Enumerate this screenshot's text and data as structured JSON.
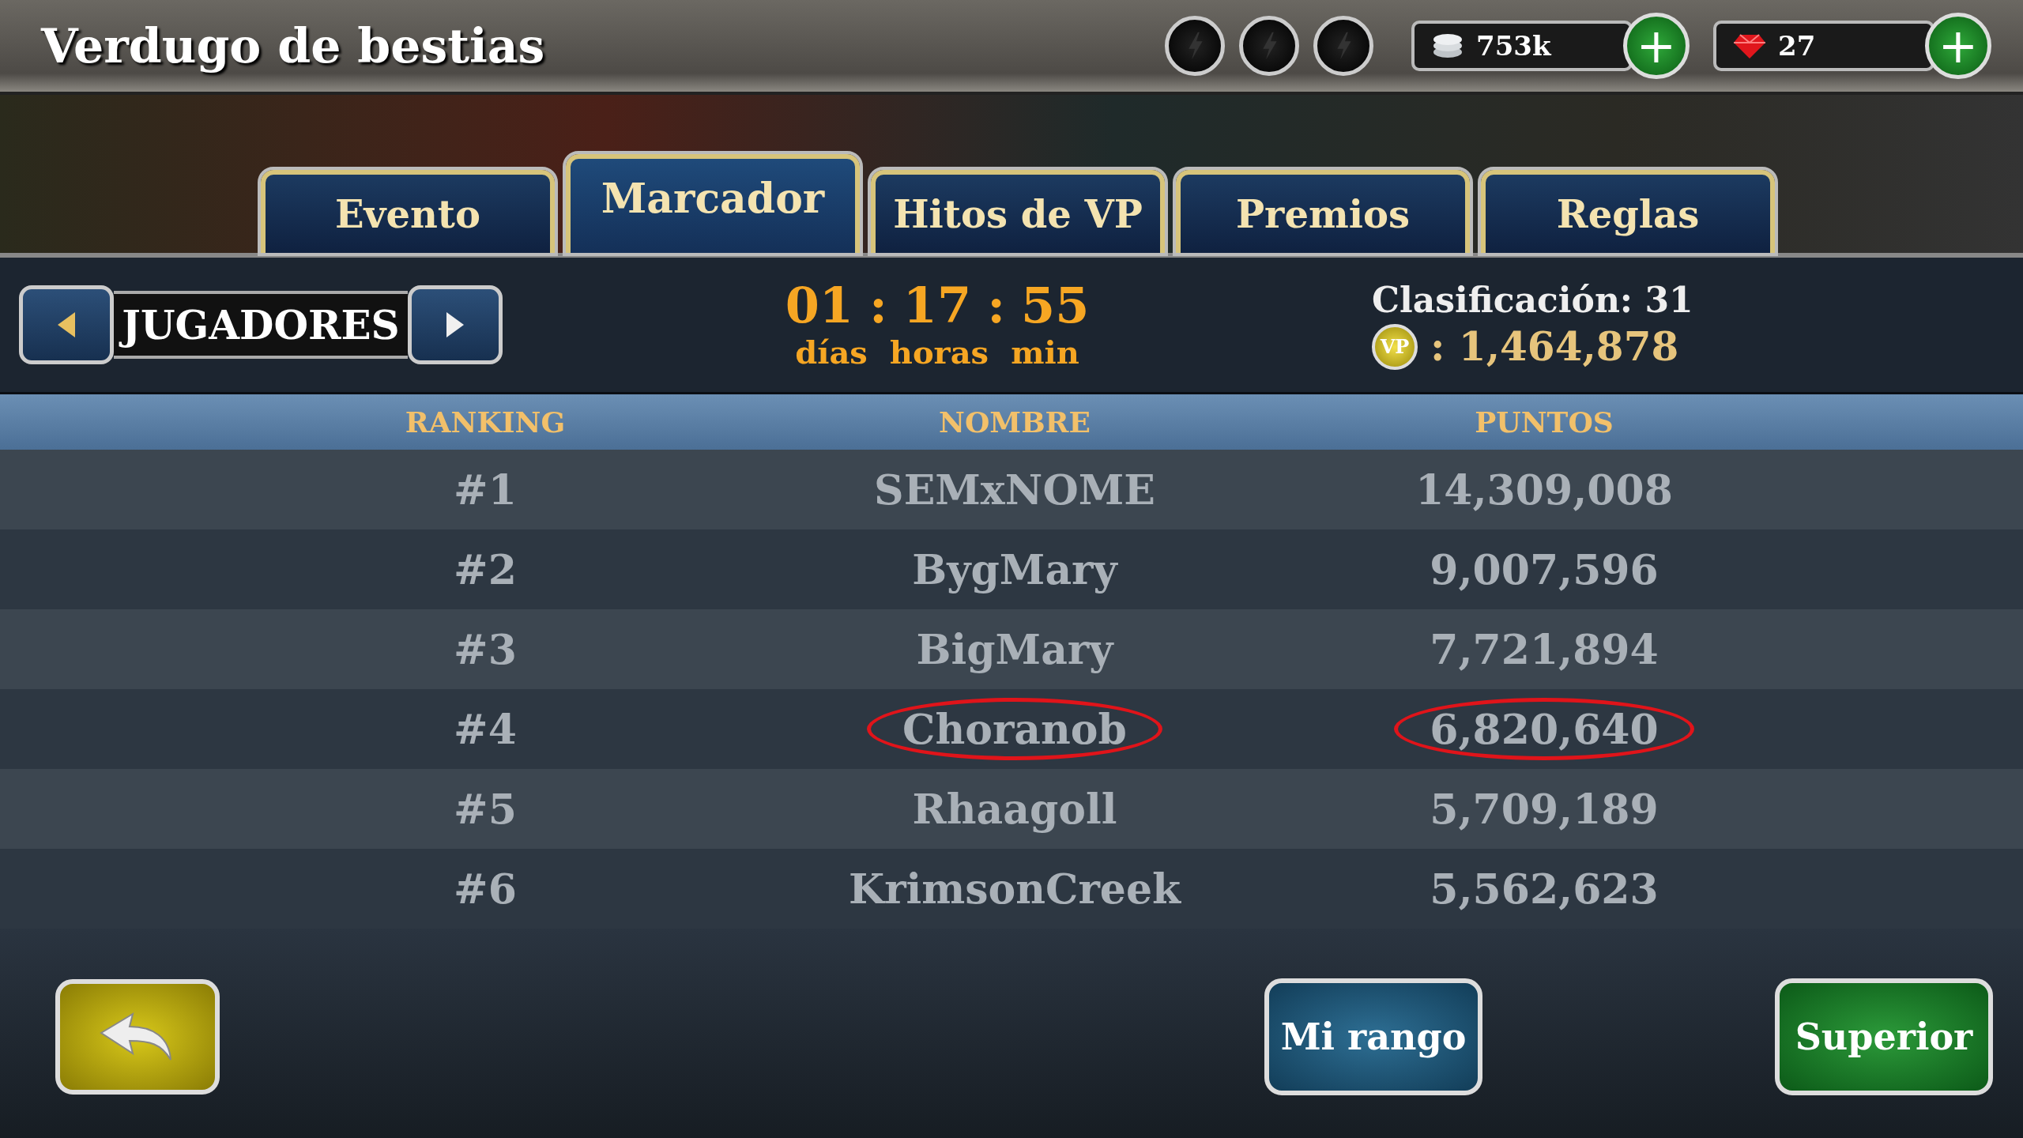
{
  "title": "Verdugo de bestias",
  "energy": [
    {
      "on": false
    },
    {
      "on": false
    },
    {
      "on": false
    }
  ],
  "currencies": [
    {
      "kind": "silver",
      "value": "753k",
      "add": "+"
    },
    {
      "kind": "gem",
      "value": "27",
      "add": "+"
    }
  ],
  "tabs": [
    {
      "label": "Evento",
      "selected": false
    },
    {
      "label": "Marcador",
      "selected": true
    },
    {
      "label": "Hitos de VP",
      "selected": false
    },
    {
      "label": "Premios",
      "selected": false
    },
    {
      "label": "Reglas",
      "selected": false
    }
  ],
  "category": {
    "label": "JUGADORES"
  },
  "timer": {
    "values": [
      "01",
      "17",
      "55"
    ],
    "separator": ":",
    "units": [
      "días",
      "horas",
      "min"
    ]
  },
  "rank_info": {
    "label": "Clasificación: 31",
    "vp_badge": "VP",
    "vp_points": ": 1,464,878"
  },
  "table": {
    "columns": [
      "RANKING",
      "NOMBRE",
      "PUNTOS"
    ],
    "rows": [
      {
        "rank": "#1",
        "name": "SEMxNOME",
        "points": "14,309,008",
        "circled": false
      },
      {
        "rank": "#2",
        "name": "BygMary",
        "points": "9,007,596",
        "circled": false
      },
      {
        "rank": "#3",
        "name": "BigMary",
        "points": "7,721,894",
        "circled": false
      },
      {
        "rank": "#4",
        "name": "Choranob",
        "points": "6,820,640",
        "circled": true
      },
      {
        "rank": "#5",
        "name": "Rhaagoll",
        "points": "5,709,189",
        "circled": false
      },
      {
        "rank": "#6",
        "name": "KrimsonCreek",
        "points": "5,562,623",
        "circled": false
      }
    ]
  },
  "buttons": {
    "my_rank": "Mi rango",
    "top": "Superior"
  }
}
